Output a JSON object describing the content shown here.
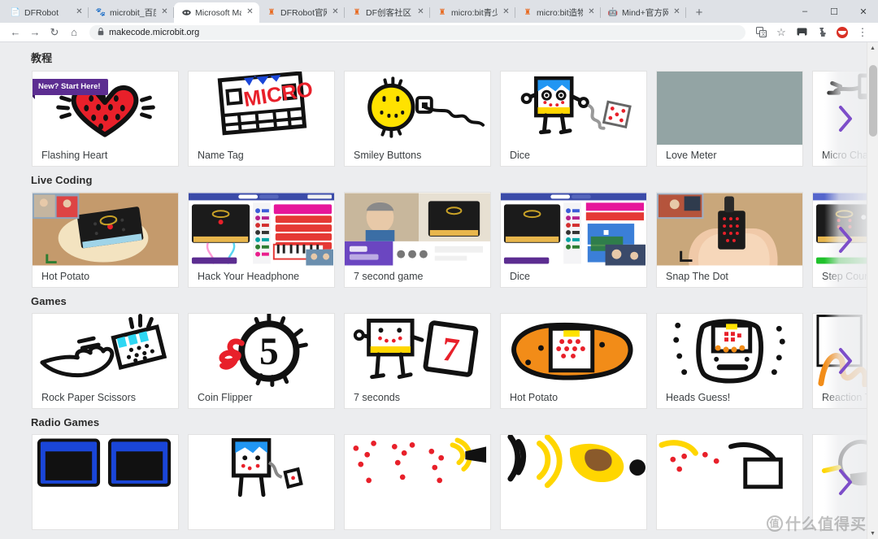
{
  "browser": {
    "tabs": [
      {
        "title": "DFRobot",
        "favicon": "page-icon",
        "active": false
      },
      {
        "title": "microbit_百度搜索",
        "favicon": "baidu-icon",
        "active": false
      },
      {
        "title": "Microsoft MakeCode",
        "favicon": "makecode-icon",
        "active": true
      },
      {
        "title": "DFRobot官网-创客_M",
        "favicon": "dfrobot-icon",
        "active": false
      },
      {
        "title": "DF创客社区 - 分享创",
        "favicon": "dfrobot-icon",
        "active": false
      },
      {
        "title": "micro:bit青少年编程",
        "favicon": "dfrobot-icon",
        "active": false
      },
      {
        "title": "micro:bit造物粒子（",
        "favicon": "dfrobot-icon",
        "active": false
      },
      {
        "title": "Mind+官方网站——",
        "favicon": "mindplus-icon",
        "active": false
      }
    ],
    "new_tab_label": "+",
    "window_controls": {
      "minimize": "–",
      "maximize": "☐",
      "close": "✕"
    },
    "toolbar": {
      "back": "←",
      "forward": "→",
      "reload": "↻",
      "home": "⌂",
      "url": "makecode.microbit.org",
      "lock": "🔒",
      "translate": "translate-icon",
      "bookmark": "☆",
      "cast": "cast-icon",
      "extensions": "puzzle-icon",
      "profile": "profile-avatar",
      "menu": "⋮"
    }
  },
  "accent": {
    "badge_purple": "#5c2d91",
    "arrow_purple": "#7d4ec9",
    "placeholder_gray": "#93a4a4",
    "page_bg": "#ecedef"
  },
  "sections": [
    {
      "title": "教程",
      "cards": [
        {
          "label": "Flashing Heart",
          "badge": "New? Start Here!",
          "art": "heart"
        },
        {
          "label": "Name Tag",
          "badge": null,
          "art": "nametag"
        },
        {
          "label": "Smiley Buttons",
          "badge": null,
          "art": "smiley"
        },
        {
          "label": "Dice",
          "badge": null,
          "art": "dice"
        },
        {
          "label": "Love Meter",
          "badge": null,
          "art": "placeholder"
        },
        {
          "label": "Micro Chat",
          "badge": null,
          "art": "chat"
        }
      ]
    },
    {
      "title": "Live Coding",
      "cards": [
        {
          "label": "Hot Potato",
          "badge": null,
          "art": "video-potato"
        },
        {
          "label": "Hack Your Headphone",
          "badge": null,
          "art": "video-editor-pink"
        },
        {
          "label": "7 second game",
          "badge": null,
          "art": "video-teacher"
        },
        {
          "label": "Dice",
          "badge": null,
          "art": "video-editor-blue"
        },
        {
          "label": "Snap The Dot",
          "badge": null,
          "art": "video-hands"
        },
        {
          "label": "Step Counter",
          "badge": null,
          "art": "video-editor-green"
        }
      ]
    },
    {
      "title": "Games",
      "cards": [
        {
          "label": "Rock Paper Scissors",
          "badge": null,
          "art": "rps"
        },
        {
          "label": "Coin Flipper",
          "badge": null,
          "art": "coin5"
        },
        {
          "label": "7 seconds",
          "badge": null,
          "art": "robot7"
        },
        {
          "label": "Hot Potato",
          "badge": null,
          "art": "potato"
        },
        {
          "label": "Heads Guess!",
          "badge": null,
          "art": "heads"
        },
        {
          "label": "Reaction Time",
          "badge": null,
          "art": "reaction"
        }
      ]
    },
    {
      "title": "Radio Games",
      "cards": [
        {
          "label": "",
          "badge": null,
          "art": "radio-blue"
        },
        {
          "label": "",
          "badge": null,
          "art": "radio-dice"
        },
        {
          "label": "",
          "badge": null,
          "art": "radio-dots"
        },
        {
          "label": "",
          "badge": null,
          "art": "radio-yellow"
        },
        {
          "label": "",
          "badge": null,
          "art": "radio-red"
        },
        {
          "label": "",
          "badge": null,
          "art": "radio-last"
        }
      ]
    }
  ],
  "carousel": {
    "next_label": "›"
  },
  "watermark": {
    "badge": "值",
    "text": "什么值得买"
  }
}
